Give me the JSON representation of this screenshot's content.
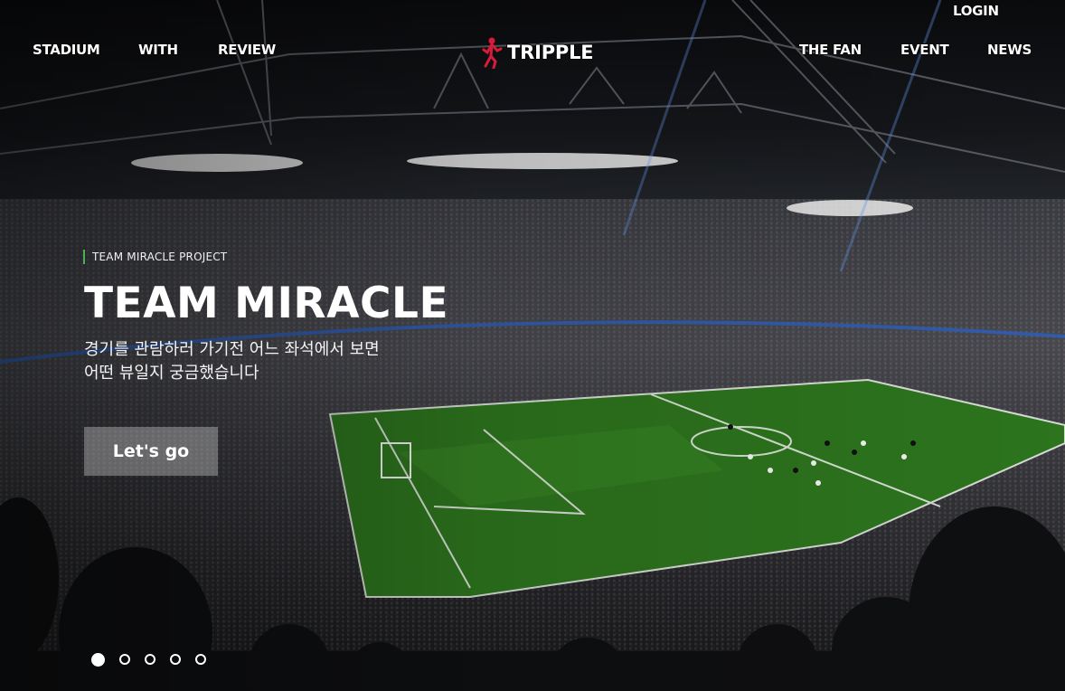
{
  "header": {
    "login_label": "LOGIN",
    "brand_name": "TRIPPLE",
    "nav_left": [
      "STADIUM",
      "WITH",
      "REVIEW"
    ],
    "nav_right": [
      "THE FAN",
      "EVENT",
      "NEWS"
    ]
  },
  "hero": {
    "eyebrow": "TEAM MIRACLE PROJECT",
    "title": "TEAM MIRACLE",
    "description": "경기를 관람하러 가기전 어느 좌석에서 보면 어떤 뷰일지 궁금했습니다",
    "cta_label": "Let's go"
  },
  "slider": {
    "total_slides": 5,
    "active_index": 0
  },
  "colors": {
    "accent_bar": "#4caf50",
    "cta_background": "rgba(255,255,255,0.30)",
    "pitch_green": "#2f7a1f"
  }
}
